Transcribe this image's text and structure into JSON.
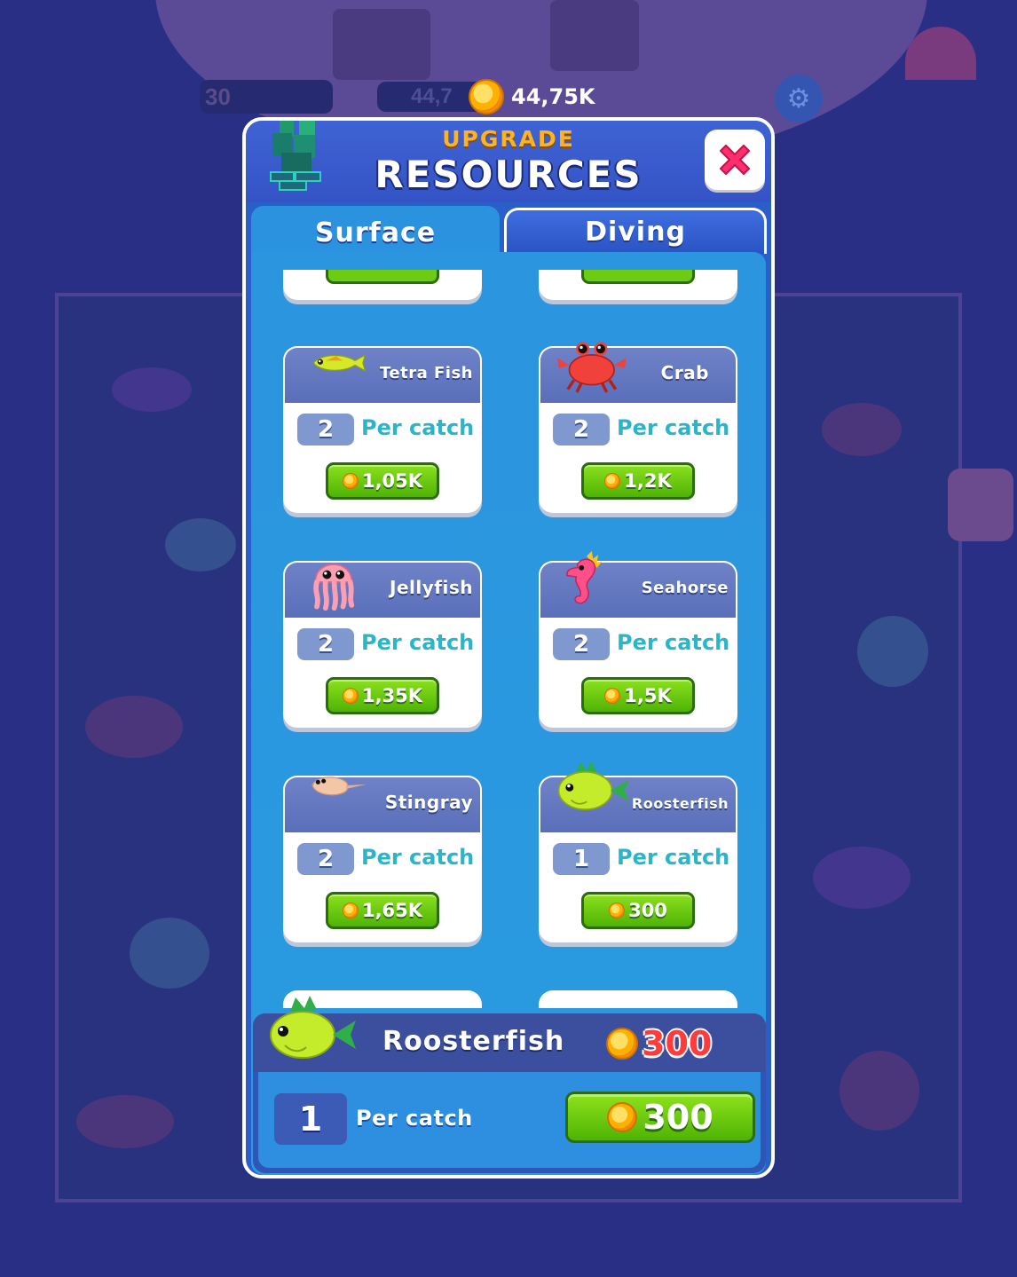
{
  "hud": {
    "level": "30",
    "coins_dim": "44,7",
    "coins": "44,75K"
  },
  "panel": {
    "title_small": "UPGRADE",
    "title_big": "RESOURCES",
    "tabs": [
      {
        "label": "Surface",
        "active": true
      },
      {
        "label": "Diving",
        "active": false
      }
    ]
  },
  "cards": [
    {
      "name": "Tetra Fish",
      "count": "2",
      "per": "Per catch",
      "price": "1,05K",
      "icon": "tetra-fish-icon"
    },
    {
      "name": "Crab",
      "count": "2",
      "per": "Per catch",
      "price": "1,2K",
      "icon": "crab-icon"
    },
    {
      "name": "Jellyfish",
      "count": "2",
      "per": "Per catch",
      "price": "1,35K",
      "icon": "jellyfish-icon"
    },
    {
      "name": "Seahorse",
      "count": "2",
      "per": "Per catch",
      "price": "1,5K",
      "icon": "seahorse-icon"
    },
    {
      "name": "Stingray",
      "count": "2",
      "per": "Per catch",
      "price": "1,65K",
      "icon": "stingray-icon"
    },
    {
      "name": "Roosterfish",
      "count": "1",
      "per": "Per catch",
      "price": "300",
      "icon": "roosterfish-icon"
    }
  ],
  "detail": {
    "name": "Roosterfish",
    "price": "300",
    "count": "1",
    "per": "Per catch",
    "buy_price": "300"
  },
  "colors": {
    "panel_blue": "#2a5fc9",
    "list_blue": "#2a95df",
    "buy_green": "#6ccb12",
    "title_orange": "#ffb320",
    "price_red": "#ff3b3b",
    "per_catch_teal": "#29b6c9"
  }
}
